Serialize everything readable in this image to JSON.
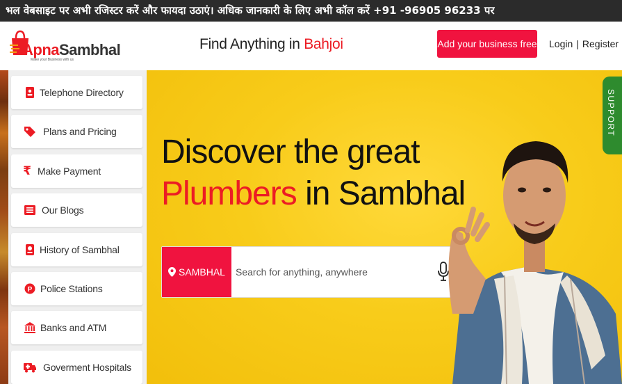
{
  "announcement": "भल वेबसाइट पर अभी रजिस्टर करें और फायदा उठाएं। अधिक जानकारी के लिए अभी कॉल करें +91 -96905 96233 पर",
  "logo": {
    "part1": "Apna",
    "part2": "Sambhal",
    "tagline": "Make your Business with us"
  },
  "header": {
    "find_prefix": "Find Anything in",
    "find_city": "Bahjoi",
    "add_business": "Add your business free",
    "login": "Login",
    "separator": "|",
    "register": "Register"
  },
  "sidebar": {
    "items": [
      {
        "label": "Telephone Directory",
        "icon": "phone-book-icon"
      },
      {
        "label": "Plans and Pricing",
        "icon": "tags-icon"
      },
      {
        "label": "Make Payment",
        "icon": "rupee-icon"
      },
      {
        "label": "Our Blogs",
        "icon": "list-icon"
      },
      {
        "label": "History of Sambhal",
        "icon": "history-icon"
      },
      {
        "label": "Police Stations",
        "icon": "police-badge-icon"
      },
      {
        "label": "Banks and ATM",
        "icon": "bank-icon"
      },
      {
        "label": "Goverment Hospitals",
        "icon": "ambulance-icon"
      }
    ]
  },
  "hero": {
    "line1": "Discover the great",
    "highlight": "Plumbers",
    "line2_rest": "in Sambhal",
    "location": "SAMBHAL",
    "search_placeholder": "Search for anything, anywhere"
  },
  "support_label": "SUPPORT",
  "colors": {
    "accent": "#ec1c24",
    "button": "#f0133f",
    "hero_bg": "#f8cc1a",
    "support": "#2e8b2e",
    "topbar": "#2b2b2b"
  }
}
